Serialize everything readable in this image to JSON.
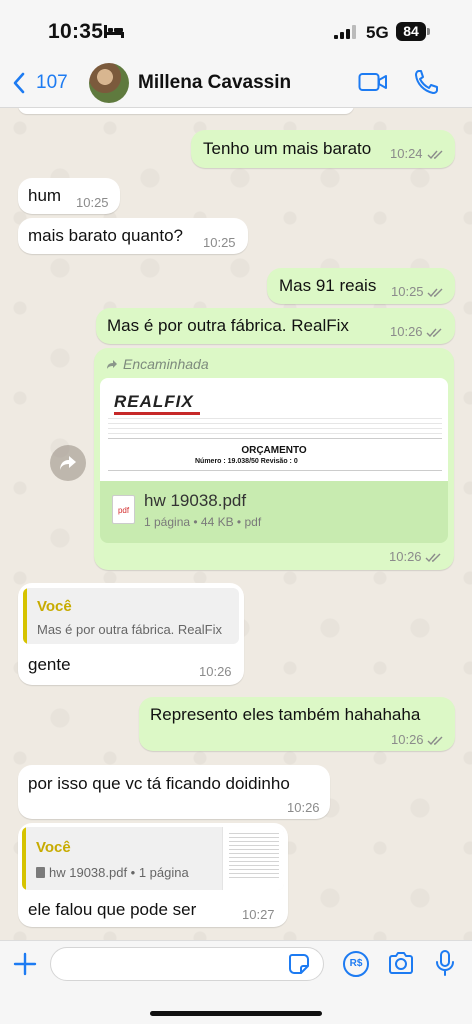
{
  "status_bar": {
    "time": "10:35",
    "network": "5G",
    "battery": "84",
    "icons": [
      "sleep-bed-icon",
      "signal-bars-icon"
    ]
  },
  "header": {
    "back_count": "107",
    "contact_name": "Millena Cavassin",
    "icons": [
      "chevron-left-icon",
      "video-camera-icon",
      "phone-icon"
    ]
  },
  "messages": [
    {
      "direction": "out",
      "text": "Tenho um mais barato",
      "time": "10:24",
      "read": true
    },
    {
      "direction": "in",
      "text": "hum",
      "time": "10:25"
    },
    {
      "direction": "in",
      "text": "mais barato quanto?",
      "time": "10:25"
    },
    {
      "direction": "out",
      "text": "Mas 91 reais",
      "time": "10:25",
      "read": true
    },
    {
      "direction": "out",
      "text": "Mas é por outra fábrica. RealFix",
      "time": "10:26",
      "read": true
    },
    {
      "direction": "out",
      "type": "document",
      "forwarded_label": "Encaminhada",
      "preview": {
        "logo": "REALFIX",
        "heading": "ORÇAMENTO",
        "number_line": "Número :   19.038/50          Revisão :   0"
      },
      "file_name": "hw 19038.pdf",
      "file_meta": "1 página • 44 KB • pdf",
      "file_badge": "pdf",
      "time": "10:26",
      "read": true
    },
    {
      "direction": "in",
      "quote_author": "Você",
      "quote_text": "Mas é por outra fábrica. RealFix",
      "text": "gente",
      "time": "10:26"
    },
    {
      "direction": "out",
      "text": "Represento eles também hahahaha",
      "time": "10:26",
      "read": true
    },
    {
      "direction": "in",
      "text": "por isso que vc tá ficando doidinho",
      "time": "10:26"
    },
    {
      "direction": "in",
      "quote_author": "Você",
      "quote_text": "hw 19038.pdf • 1 página",
      "text": "ele falou que pode ser",
      "time": "10:27"
    }
  ],
  "input_bar": {
    "placeholder": "",
    "pix_label": "R$",
    "icons": [
      "plus-icon",
      "sticker-icon",
      "pix-icon",
      "camera-icon",
      "microphone-icon"
    ]
  },
  "colors": {
    "accent": "#1d7bf2",
    "outgoing_bubble": "#dcf8c6",
    "incoming_bubble": "#ffffff",
    "quote_author": "#c7ab00"
  }
}
